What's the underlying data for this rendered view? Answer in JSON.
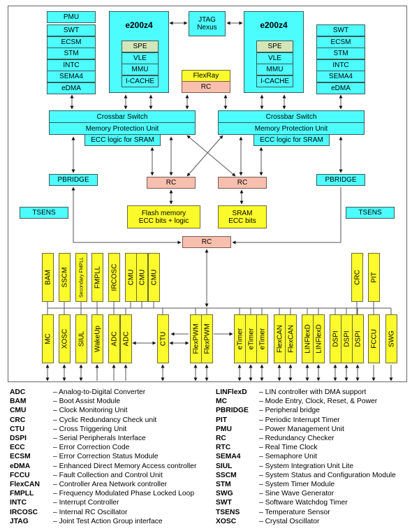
{
  "diagram": {
    "left_stack": [
      "PMU",
      "SWT",
      "ECSM",
      "STM",
      "INTC",
      "SEMA4",
      "eDMA"
    ],
    "right_stack": [
      "SWT",
      "ECSM",
      "STM",
      "INTC",
      "SEMA4",
      "eDMA"
    ],
    "core_left": {
      "title": "e200z4",
      "units": [
        "SPE",
        "VLE",
        "MMU",
        "I-CACHE"
      ]
    },
    "core_right": {
      "title": "e200z4",
      "units": [
        "SPE",
        "VLE",
        "MMU",
        "I-CACHE"
      ]
    },
    "jtag": "JTAG\nNexus",
    "flexray": {
      "top": "FlexRay",
      "bottom": "RC"
    },
    "xbar_left": {
      "switch": "Crossbar Switch",
      "mpu": "Memory Protection Unit",
      "ecc": "ECC logic for SRAM"
    },
    "xbar_right": {
      "switch": "Crossbar Switch",
      "mpu": "Memory Protection Unit",
      "ecc": "ECC logic for SRAM"
    },
    "pbridge_left": "PBRIDGE",
    "pbridge_right": "PBRIDGE",
    "tsens_left": "TSENS",
    "tsens_right": "TSENS",
    "rc_flash": "RC",
    "rc_sram": "RC",
    "rc_periph": "RC",
    "flash": "Flash memory\nECC bits + logic",
    "sram": "SRAM\nECC bits",
    "top_periph": [
      "BAM",
      "SSCM",
      "Secondary FMPLL",
      "FMPLL",
      "IRCOSC",
      "CMU",
      "CMU",
      "CMU",
      "CRC",
      "PIT"
    ],
    "bottom_periph": [
      "MC",
      "XOSC",
      "SIUL",
      "WakeUp",
      "ADC",
      "ADC",
      "CTU",
      "FlexPWM",
      "FlexPWM",
      "eTimer",
      "eTimer",
      "eTimer",
      "FlexCAN",
      "FlexCAN",
      "LINFlexD",
      "LINFlexD",
      "DSPI",
      "DSPI",
      "DSPI",
      "FCCU",
      "SWG"
    ]
  },
  "legend": {
    "left": [
      {
        "abbr": "ADC",
        "desc": "– Analog-to-Digital Converter"
      },
      {
        "abbr": "BAM",
        "desc": "– Boot Assist Module"
      },
      {
        "abbr": "CMU",
        "desc": "– Clock Monitoring Unit"
      },
      {
        "abbr": "CRC",
        "desc": "– Cyclic Redundancy Check unit"
      },
      {
        "abbr": "CTU",
        "desc": "– Cross Triggering Unit"
      },
      {
        "abbr": "DSPI",
        "desc": "– Serial Peripherals Interface"
      },
      {
        "abbr": "ECC",
        "desc": "– Error Correction Code"
      },
      {
        "abbr": "ECSM",
        "desc": "– Error Correction Status Module"
      },
      {
        "abbr": "eDMA",
        "desc": "– Enhanced Direct Memory Access controller"
      },
      {
        "abbr": "FCCU",
        "desc": "– Fault Collection and Control Unit"
      },
      {
        "abbr": "FlexCAN",
        "desc": "– Controller Area Network controller"
      },
      {
        "abbr": "FMPLL",
        "desc": "– Frequency Modulated Phase Locked Loop"
      },
      {
        "abbr": "INTC",
        "desc": "– Interrupt Controller"
      },
      {
        "abbr": "IRCOSC",
        "desc": "– Internal RC Oscillator"
      },
      {
        "abbr": "JTAG",
        "desc": "– Joint Test Action Group interface"
      }
    ],
    "right": [
      {
        "abbr": "LINFlexD",
        "desc": "– LIN controller with DMA support"
      },
      {
        "abbr": "MC",
        "desc": "– Mode Entry, Clock, Reset, & Power"
      },
      {
        "abbr": "PBRIDGE",
        "desc": "– Peripheral bridge"
      },
      {
        "abbr": "PIT",
        "desc": "– Periodic Interrupt Timer"
      },
      {
        "abbr": "PMU",
        "desc": "– Power Management Unit"
      },
      {
        "abbr": "RC",
        "desc": "– Redundancy Checker"
      },
      {
        "abbr": "RTC",
        "desc": "– Real Time Clock"
      },
      {
        "abbr": "SEMA4",
        "desc": "– Semaphore Unit"
      },
      {
        "abbr": "SIUL",
        "desc": "– System Integration Unit Lite"
      },
      {
        "abbr": "SSCM",
        "desc": "– System Status and Configuration Module"
      },
      {
        "abbr": "STM",
        "desc": "– System Timer Module"
      },
      {
        "abbr": "SWG",
        "desc": "– Sine Wave Generator"
      },
      {
        "abbr": "SWT",
        "desc": "– Software Watchdog Timer"
      },
      {
        "abbr": "TSENS",
        "desc": "– Temperature Sensor"
      },
      {
        "abbr": "XOSC",
        "desc": "– Crystal Oscillator"
      }
    ]
  },
  "colors": {
    "peripheral_cyan": "#4dfcfc",
    "peripheral_yellow": "#fbfb2b",
    "redundancy_checker": "#f9bfae",
    "spe": "#d3e6b8"
  }
}
